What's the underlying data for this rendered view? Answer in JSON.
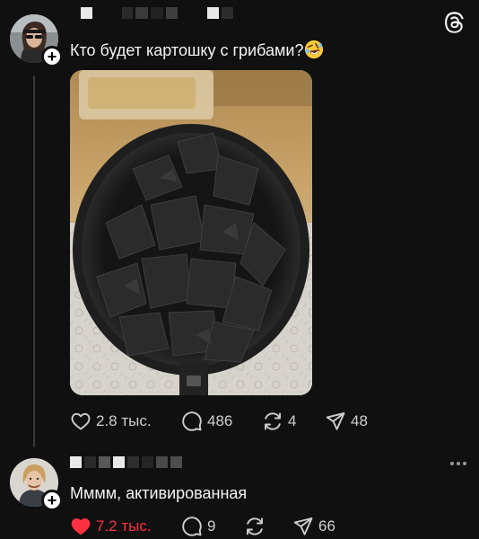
{
  "threads": {
    "brand_icon": "threads-logo-icon"
  },
  "posts": [
    {
      "avatar_icon": "user-avatar-woman-sunglasses",
      "follow_symbol": "+",
      "text": "Кто будет картошку с грибами?",
      "emoji_icon": "rolling-on-floor-laughing-emoji",
      "image_alt_icon": "burnt-food-in-pan-photo",
      "likes": "2.8 тыс.",
      "liked": false,
      "comments": "486",
      "reposts": "4",
      "shares": "48"
    },
    {
      "avatar_icon": "user-avatar-woman",
      "follow_symbol": "+",
      "text": "Мммм, активированная",
      "likes": "7.2 тыс.",
      "liked": true,
      "comments": "9",
      "reposts": "",
      "shares": "66"
    }
  ],
  "colors": {
    "background": "#101010",
    "text": "#f3f3f3",
    "muted": "#cfcfcf",
    "like_red": "#ff3040",
    "thread_line": "#3a3a3a"
  }
}
